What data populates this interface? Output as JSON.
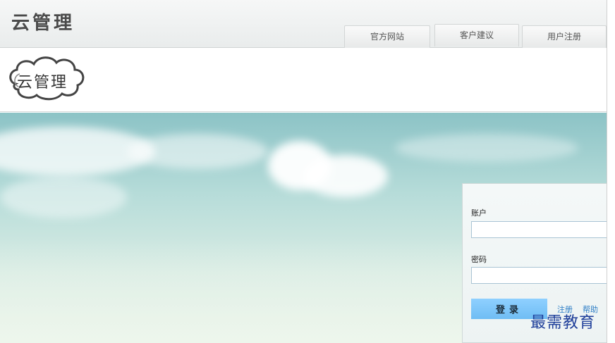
{
  "header": {
    "app_title": "云管理",
    "nav": [
      "官方网站",
      "客户建议",
      "用户注册"
    ]
  },
  "logo": {
    "text": "云管理"
  },
  "login": {
    "account_label": "账户",
    "password_label": "密码",
    "account_value": "",
    "password_value": "",
    "submit_label": "登录",
    "register_link": "注册",
    "help_link": "帮助"
  },
  "watermark": {
    "text": "最需教育"
  },
  "colors": {
    "accent_button": "#7cc6fa",
    "link": "#2d7dc6",
    "sky_top": "#8cc3c6"
  }
}
